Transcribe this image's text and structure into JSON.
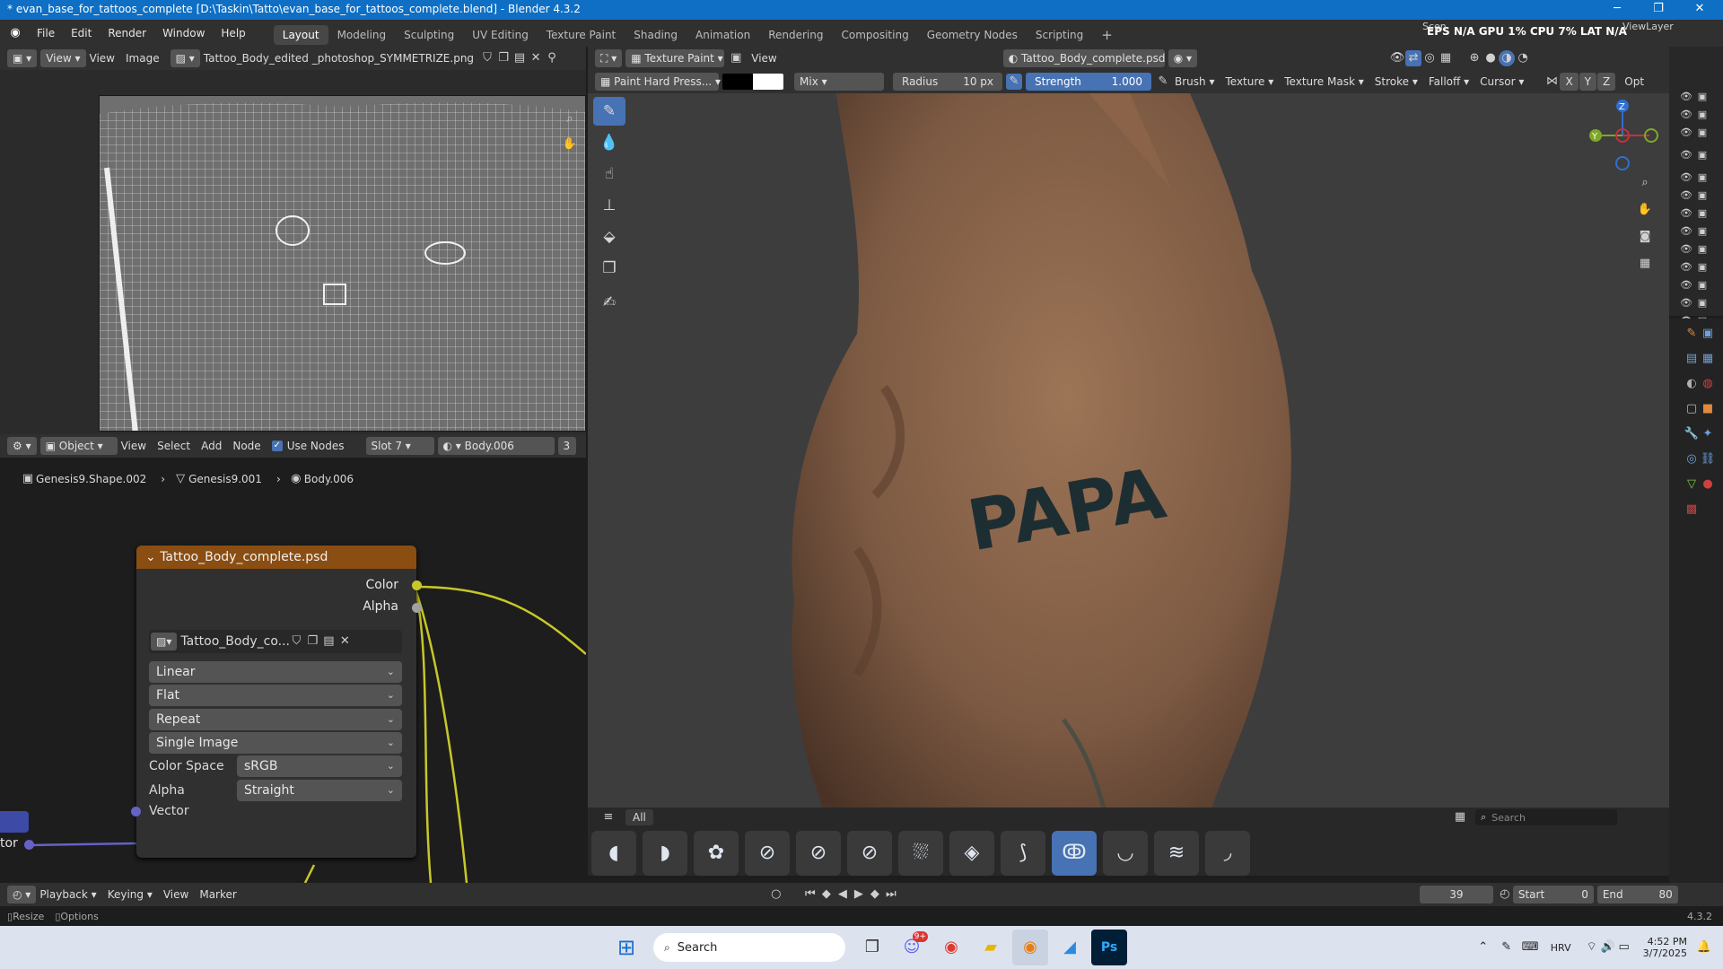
{
  "titlebar": {
    "title": "* evan_base_for_tattoos_complete [D:\\Taskin\\Tatto\\evan_base_for_tattoos_complete.blend] - Blender 4.3.2"
  },
  "menu": [
    "File",
    "Edit",
    "Render",
    "Window",
    "Help"
  ],
  "workspaces": [
    {
      "label": "Layout",
      "active": true
    },
    {
      "label": "Modeling"
    },
    {
      "label": "Sculpting"
    },
    {
      "label": "UV Editing"
    },
    {
      "label": "Texture Paint"
    },
    {
      "label": "Shading"
    },
    {
      "label": "Animation"
    },
    {
      "label": "Rendering"
    },
    {
      "label": "Compositing"
    },
    {
      "label": "Geometry Nodes"
    },
    {
      "label": "Scripting"
    }
  ],
  "topbar_right": {
    "scene_label": "Scen",
    "view_layer_label": "ViewLayer",
    "stats": "EPS N/A GPU 1% CPU 7% LAT N/A"
  },
  "image_editor": {
    "view": "View",
    "view2": "View",
    "image_menu": "Image",
    "image_name": "Tattoo_Body_edited _photoshop_SYMMETRIZE.png"
  },
  "node_editor": {
    "mode": "Object",
    "menus": [
      "View",
      "Select",
      "Add",
      "Node"
    ],
    "use_nodes": "Use Nodes",
    "slot": "Slot 7",
    "material": "Body.006",
    "material_users": "3",
    "breadcrumb": [
      "Genesis9.Shape.002",
      "Genesis9.001",
      "Body.006"
    ],
    "node": {
      "title": "Tattoo_Body_complete.psd",
      "out_color": "Color",
      "out_alpha": "Alpha",
      "image_name": "Tattoo_Body_co...",
      "interpolation": "Linear",
      "projection": "Flat",
      "extension": "Repeat",
      "source": "Single Image",
      "color_space_label": "Color Space",
      "color_space": "sRGB",
      "alpha_label": "Alpha",
      "alpha": "Straight",
      "vector": "Vector"
    },
    "left_node_socket_label": "tor"
  },
  "viewport": {
    "mode": "Texture Paint",
    "view": "View",
    "image": "Tattoo_Body_complete.psd",
    "brush_name": "Paint Hard Press...",
    "blend": "Mix",
    "radius_label": "Radius",
    "radius_value": "10 px",
    "strength_label": "Strength",
    "strength_value": "1.000",
    "menus": [
      "Brush",
      "Texture",
      "Texture Mask",
      "Stroke",
      "Falloff",
      "Cursor"
    ],
    "axes": [
      "X",
      "Y",
      "Z"
    ],
    "opt": "Opt",
    "tattoo_text": "PAPA",
    "gizmo": {
      "x": "X",
      "y": "Y",
      "z": "Z"
    }
  },
  "shelf": {
    "tab": "All",
    "search_placeholder": "Search",
    "brush_count": 13,
    "active_index": 9
  },
  "timeline": {
    "menus": [
      "Playback",
      "Keying",
      "View",
      "Marker"
    ],
    "current_frame": "39",
    "start_label": "Start",
    "start": "0",
    "end_label": "End",
    "end": "80"
  },
  "statusbar": {
    "resize": "Resize",
    "options": "Options",
    "version": "4.3.2"
  },
  "taskbar": {
    "search_placeholder": "Search",
    "lang": "HRV",
    "time": "4:52 PM",
    "date": "3/7/2025",
    "discord_badge": "9+"
  },
  "colors": {
    "accent": "#4772b3",
    "node_header": "#8a4d12",
    "title_bar": "#0e6fc4",
    "socket_yellow": "#c7c729",
    "socket_purple": "#6363c7"
  }
}
